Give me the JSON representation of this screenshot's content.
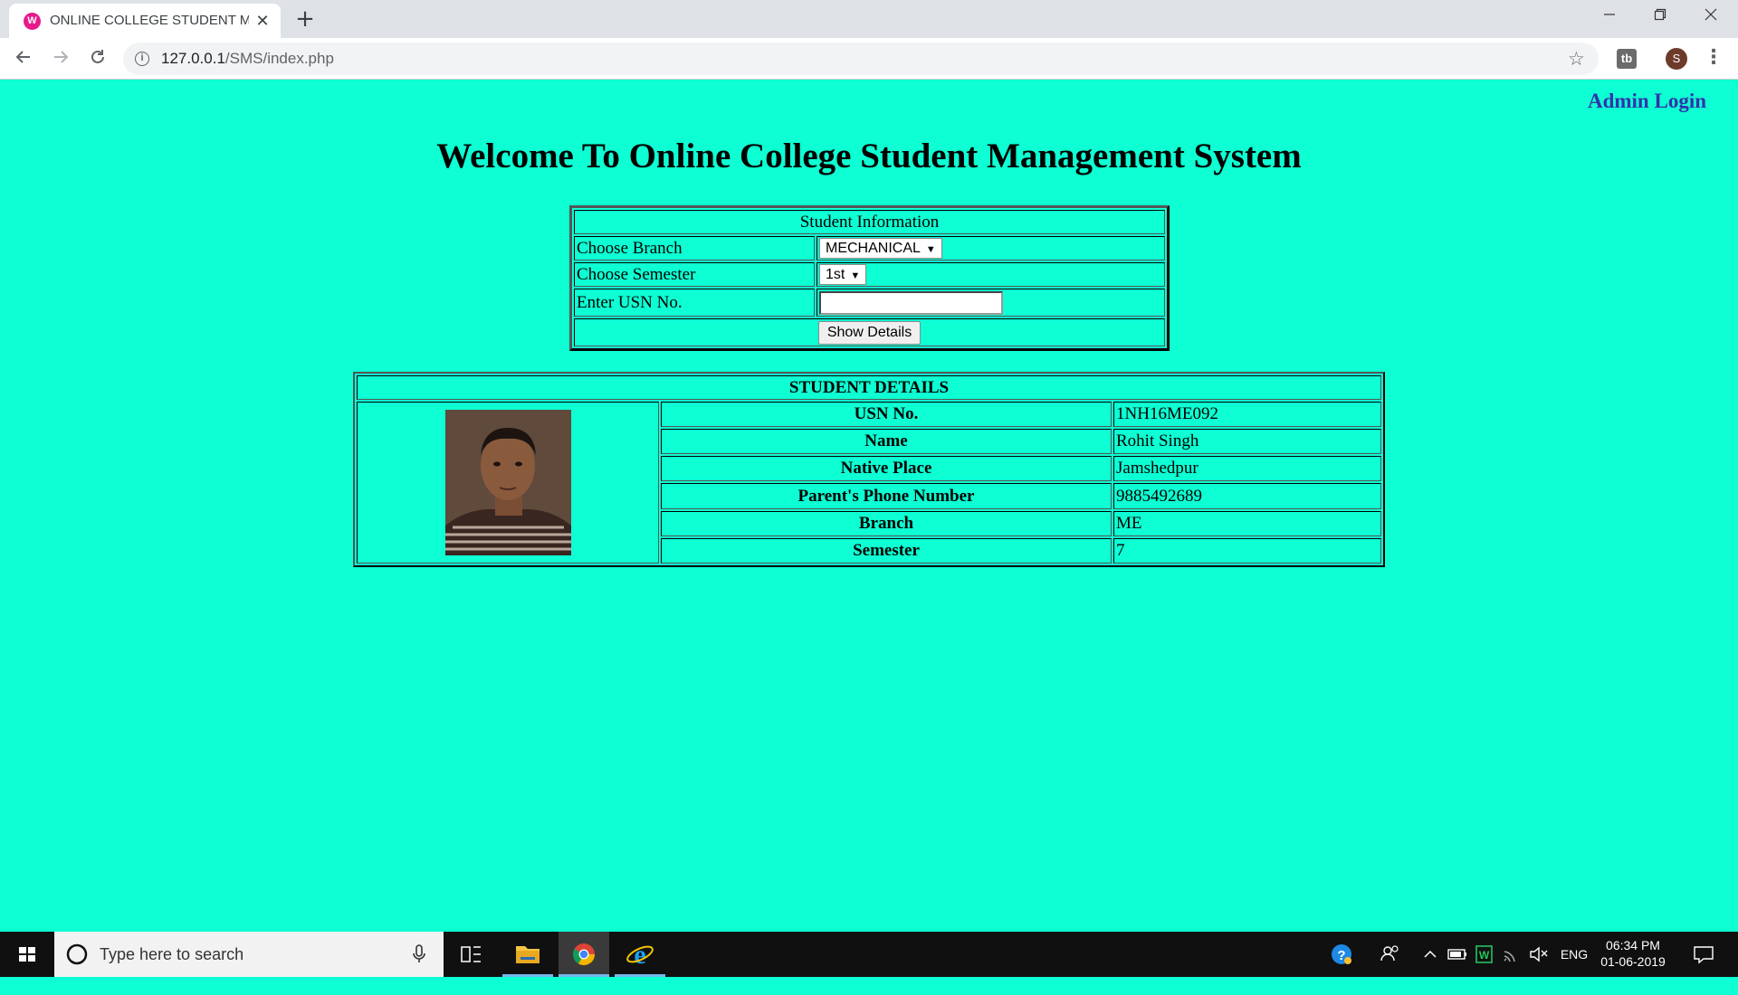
{
  "browser": {
    "tab_title": "ONLINE COLLEGE STUDENT MAI",
    "url_host": "127.0.0.1",
    "url_path": "/SMS/index.php",
    "profile_initial": "S",
    "extension_label": "tb"
  },
  "page": {
    "admin_login": "Admin Login",
    "title": "Welcome To Online College Student Management System"
  },
  "form": {
    "header": "Student Information",
    "branch_label": "Choose Branch",
    "branch_value": "MECHANICAL",
    "semester_label": "Choose Semester",
    "semester_value": "1st",
    "usn_label": "Enter USN No.",
    "usn_value": "",
    "submit_label": "Show Details"
  },
  "details": {
    "header": "STUDENT DETAILS",
    "rows": [
      {
        "label": "USN No.",
        "value": "1NH16ME092"
      },
      {
        "label": "Name",
        "value": "Rohit Singh"
      },
      {
        "label": "Native Place",
        "value": "Jamshedpur"
      },
      {
        "label": "Parent's Phone Number",
        "value": "9885492689"
      },
      {
        "label": "Branch",
        "value": "ME"
      },
      {
        "label": "Semester",
        "value": "7"
      }
    ]
  },
  "taskbar": {
    "search_placeholder": "Type here to search",
    "language": "ENG",
    "time": "06:34 PM",
    "date": "01-06-2019"
  },
  "colors": {
    "page_background": "#0dffd3",
    "admin_link": "#3333aa",
    "taskbar": "#101010"
  }
}
